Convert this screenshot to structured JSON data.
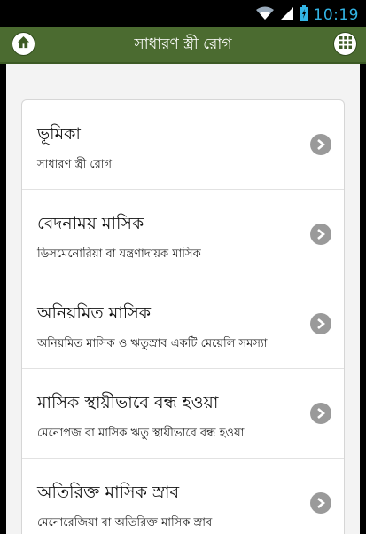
{
  "status_bar": {
    "time": "10:19"
  },
  "header": {
    "title": "সাধারণ স্ত্রী রোগ",
    "home_icon": "home-icon",
    "menu_icon": "grid-icon"
  },
  "items": [
    {
      "title": "ভূমিকা",
      "subtitle": "সাধারণ স্ত্রী রোগ"
    },
    {
      "title": "বেদনাময় মাসিক",
      "subtitle": "ডিসমেনোরিয়া বা যন্ত্রণাদায়ক মাসিক"
    },
    {
      "title": "অনিয়মিত মাসিক",
      "subtitle": "অনিয়মিত মাসিক ও ঋতুস্রাব একটি মেয়েলি সমস্যা"
    },
    {
      "title": "মাসিক স্থায়ীভাবে বন্ধ হওয়া",
      "subtitle": "মেনোপজ বা মাসিক ঋতু স্থায়ীভাবে বন্ধ হওয়া"
    },
    {
      "title": "অতিরিক্ত মাসিক স্রাব",
      "subtitle": "মেনোরেজিয়া বা অতিরিক্ত মাসিক স্রাব"
    }
  ],
  "colors": {
    "appbar": "#4b6b30",
    "status_accent": "#33b5e5"
  }
}
